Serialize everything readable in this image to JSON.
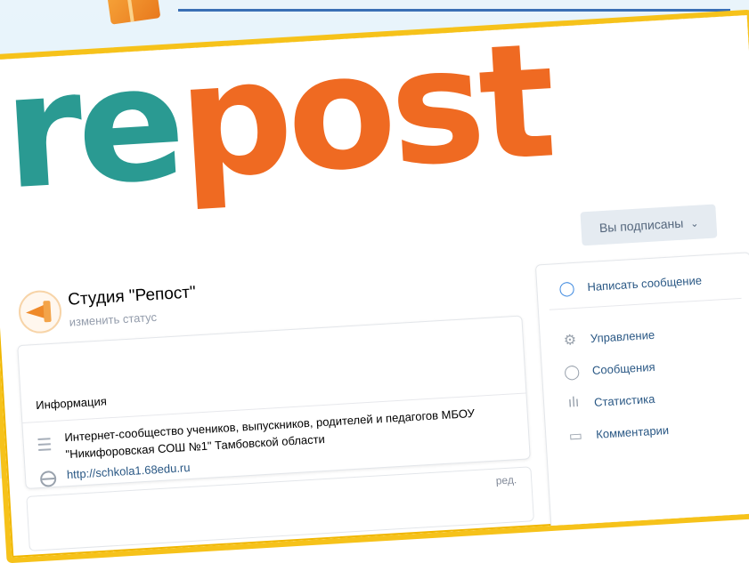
{
  "cover": {
    "word_part1": "re",
    "word_part2": "post"
  },
  "header": {
    "subscribe_label": "Вы подписаны",
    "subscribe_chevron": "⌄",
    "group_name": "Студия \"Репост\"",
    "status_link": "изменить статус"
  },
  "info": {
    "edit_label": "ред.",
    "title": "Информация",
    "description": "Интернет-сообщество учеников, выпускников, родителей и педагогов МБОУ \"Никифоровская СОШ №1\" Тамбовской области",
    "website": "http://schkola1.68edu.ru"
  },
  "actions": {
    "message_label": "Написать сообщение",
    "items": [
      {
        "label": "Управление",
        "icon": "gear-icon",
        "glyph": "⚙"
      },
      {
        "label": "Сообщения",
        "icon": "chat-bubble-icon",
        "glyph": "◯"
      },
      {
        "label": "Статистика",
        "icon": "bar-chart-icon",
        "glyph": "ılı"
      },
      {
        "label": "Комментарии",
        "icon": "comment-icon",
        "glyph": "▭"
      }
    ]
  },
  "colors": {
    "frame": "#f6c21a",
    "teal": "#2a9a92",
    "orange": "#ef6a22",
    "link": "#2a5885"
  }
}
